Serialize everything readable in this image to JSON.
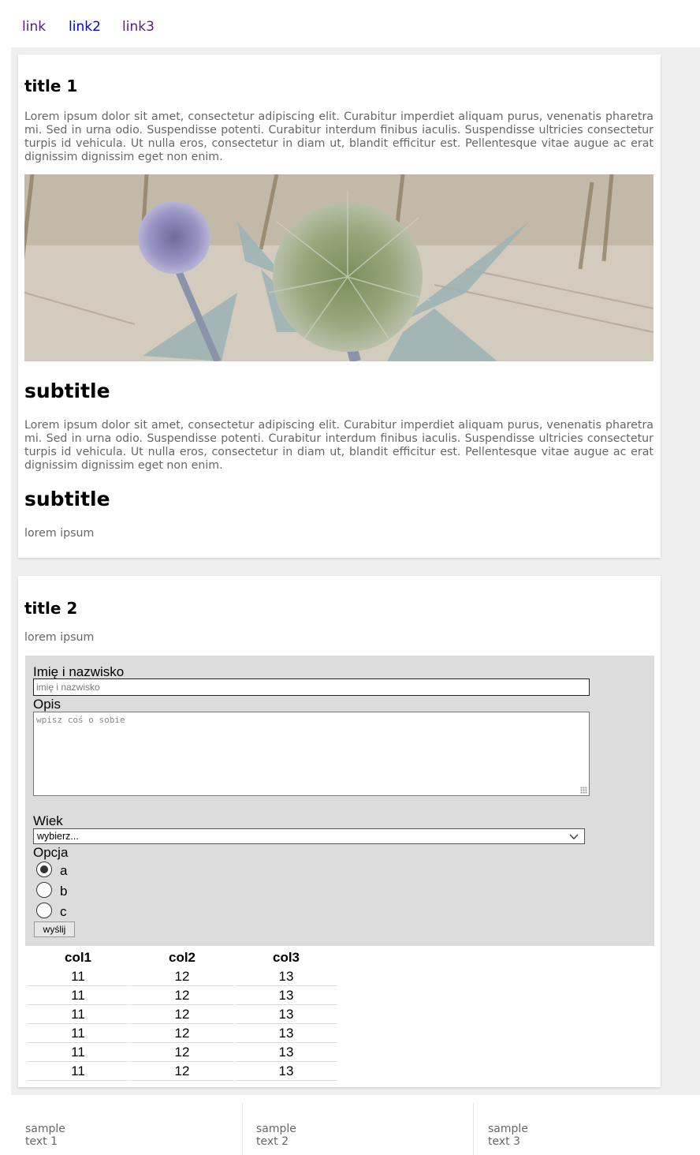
{
  "nav": {
    "links": [
      {
        "label": "link",
        "color": "#551a8b"
      },
      {
        "label": "link2",
        "color": "#0000ee"
      },
      {
        "label": "link3",
        "color": "#551a8b"
      }
    ]
  },
  "section1": {
    "title": "title 1",
    "paragraph": "Lorem ipsum dolor sit amet, consectetur adipiscing elit. Curabitur imperdiet aliquam purus, venenatis pharetra mi. Sed in urna odio. Suspendisse potenti. Curabitur interdum finibus iaculis. Suspendisse ultricies consectetur turpis id vehicula. Ut nulla eros, consectetur in diam ut, blandit efficitur est. Pellentesque vitae augue ac erat dignissim dignissim eget non enim.",
    "subtitle1": "subtitle",
    "paragraph2": "Lorem ipsum dolor sit amet, consectetur adipiscing elit. Curabitur imperdiet aliquam purus, venenatis pharetra mi. Sed in urna odio. Suspendisse potenti. Curabitur interdum finibus iaculis. Suspendisse ultricies consectetur turpis id vehicula. Ut nulla eros, consectetur in diam ut, blandit efficitur est. Pellentesque vitae augue ac erat dignissim dignissim eget non enim.",
    "subtitle2": "subtitle",
    "small_text": "lorem ipsum"
  },
  "section2": {
    "title": "title 2",
    "small_text": "lorem ipsum",
    "form": {
      "name_label": "Imię i nazwisko",
      "name_placeholder": "imię i nazwisko",
      "name_value": "",
      "desc_label": "Opis",
      "desc_placeholder": "wpisz coś o sobie",
      "desc_value": "",
      "age_label": "Wiek",
      "age_selected": "wybierz...",
      "option_label": "Opcja",
      "options": [
        {
          "label": "a",
          "checked": true
        },
        {
          "label": "b",
          "checked": false
        },
        {
          "label": "c",
          "checked": false
        }
      ],
      "submit_label": "wyślij"
    },
    "table": {
      "headers": [
        "col1",
        "col2",
        "col3"
      ],
      "rows": [
        [
          "11",
          "12",
          "13"
        ],
        [
          "11",
          "12",
          "13"
        ],
        [
          "11",
          "12",
          "13"
        ],
        [
          "11",
          "12",
          "13"
        ],
        [
          "11",
          "12",
          "13"
        ],
        [
          "11",
          "12",
          "13"
        ]
      ]
    }
  },
  "footer": {
    "items": [
      "sample text 1",
      "sample text 2",
      "sample text 3"
    ]
  },
  "colors": {
    "page_bg": "#efefef",
    "card_bg": "#ffffff",
    "form_bg": "#dcdcdc",
    "muted_text": "#666666"
  }
}
